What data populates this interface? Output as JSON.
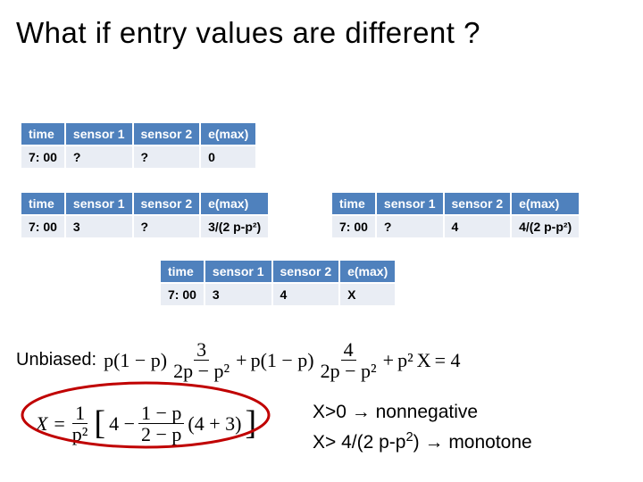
{
  "title": "What if entry values are different ?",
  "tables": {
    "t1": {
      "headers": [
        "time",
        "sensor 1",
        "sensor 2",
        "e(max)"
      ],
      "row": [
        "7: 00",
        "?",
        "?",
        "0"
      ]
    },
    "t2": {
      "headers": [
        "time",
        "sensor 1",
        "sensor 2",
        "e(max)"
      ],
      "row": [
        "7: 00",
        "3",
        "?",
        "3/(2 p-p²)"
      ]
    },
    "t3": {
      "headers": [
        "time",
        "sensor 1",
        "sensor 2",
        "e(max)"
      ],
      "row": [
        "7: 00",
        "?",
        "4",
        "4/(2 p-p²)"
      ]
    },
    "t4": {
      "headers": [
        "time",
        "sensor 1",
        "sensor 2",
        "e(max)"
      ],
      "row": [
        "7: 00",
        "3",
        "4",
        "X"
      ]
    }
  },
  "unbiased_label": "Unbiased:",
  "equation_sum": {
    "t1": {
      "coef": "p(1 − p)",
      "num": "3",
      "den": "2p − p²"
    },
    "plus1": " + ",
    "t2": {
      "coef": "p(1 − p)",
      "num": "4",
      "den": "2p − p²"
    },
    "plus2": " + ",
    "t3": {
      "coef": "p²",
      "var": "X"
    },
    "eq": " = 4"
  },
  "equation_x": {
    "lhs": "X = ",
    "frac": {
      "num": "1",
      "den": "p²"
    },
    "mid_open": "[",
    "mid_a": "4 − ",
    "mid_frac": {
      "num": "1 − p",
      "den": "2 − p"
    },
    "mid_b": "(4 + 3)",
    "mid_close": "]"
  },
  "conds": {
    "line1": "X>0 → nonnegative",
    "line2_a": "X> 4/(2 p-p",
    "line2_sup": "2",
    "line2_b": ") → monotone"
  }
}
